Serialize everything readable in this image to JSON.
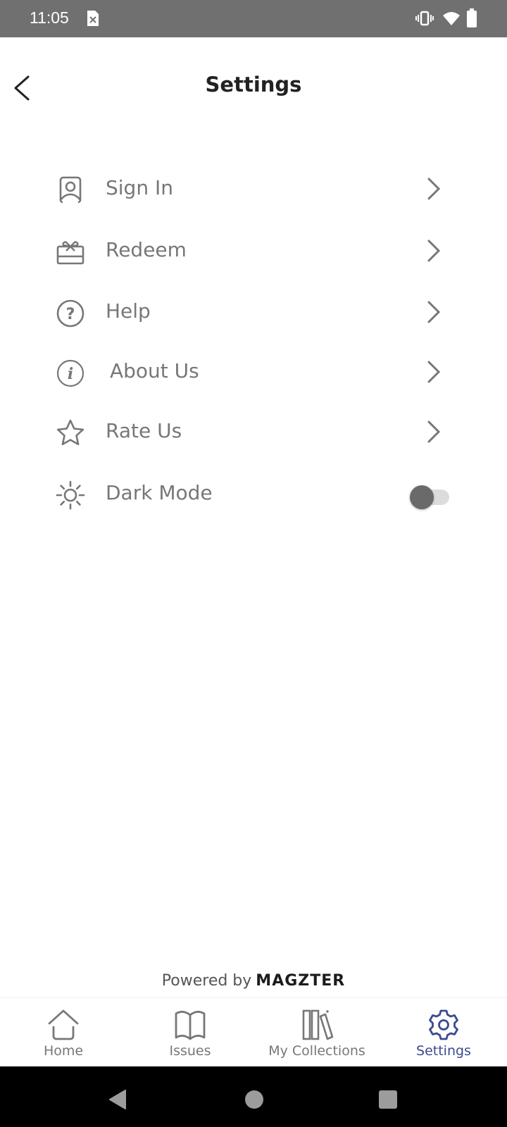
{
  "status_bar": {
    "time": "11:05",
    "icons": [
      "sim-error-icon",
      "vibrate-icon",
      "wifi-icon",
      "battery-icon"
    ]
  },
  "header": {
    "title": "Settings",
    "back_icon": "chevron-left-icon"
  },
  "menu": {
    "items": [
      {
        "label": "Sign In",
        "icon": "user-icon",
        "trailing": "chevron-right-icon"
      },
      {
        "label": "Redeem",
        "icon": "gift-icon",
        "trailing": "chevron-right-icon"
      },
      {
        "label": "Help",
        "icon": "help-icon",
        "trailing": "chevron-right-icon"
      },
      {
        "label": "About Us",
        "icon": "info-icon",
        "trailing": "chevron-right-icon"
      },
      {
        "label": "Rate Us",
        "icon": "star-icon",
        "trailing": "chevron-right-icon"
      },
      {
        "label": "Dark Mode",
        "icon": "sun-icon",
        "trailing": "toggle",
        "toggle_on": false
      }
    ]
  },
  "footer": {
    "powered_by": "Powered by",
    "brand": "MAGZTER"
  },
  "bottom_nav": {
    "active_color": "#3d4a8f",
    "inactive_color": "#777777",
    "items": [
      {
        "label": "Home",
        "icon": "home-icon",
        "active": false
      },
      {
        "label": "Issues",
        "icon": "book-icon",
        "active": false
      },
      {
        "label": "My Collections",
        "icon": "collections-icon",
        "active": false
      },
      {
        "label": "Settings",
        "icon": "gear-icon",
        "active": true
      }
    ]
  },
  "system_nav": {
    "buttons": [
      "back",
      "home",
      "recents"
    ]
  }
}
